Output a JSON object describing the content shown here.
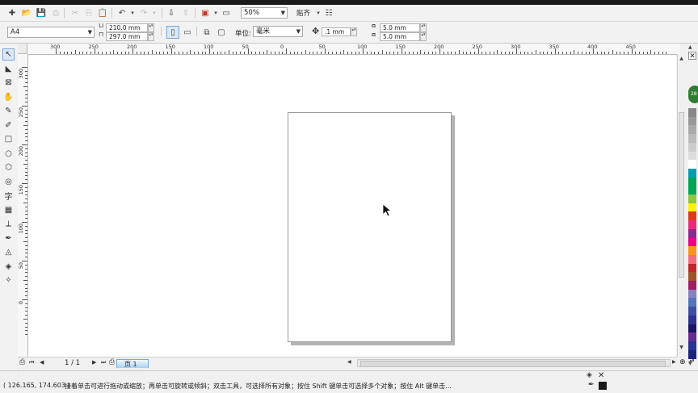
{
  "toolbar": {
    "zoom_value": "50%",
    "snap_label": "贴齐"
  },
  "property_bar": {
    "page_size": "A4",
    "width": "210.0 mm",
    "height": "297.0 mm",
    "units_label": "单位:",
    "units_value": "毫米",
    "nudge": ".1 mm",
    "dup_x": "5.0 mm",
    "dup_y": "5.0 mm"
  },
  "ruler": {
    "horizontal_ticks": [
      "300",
      "250",
      "200",
      "150",
      "100",
      "50",
      "0",
      "50",
      "100",
      "150",
      "200",
      "250",
      "300",
      "350",
      "400",
      "450"
    ],
    "vertical_ticks": [
      "300",
      "250",
      "200",
      "150",
      "100",
      "50",
      "0"
    ]
  },
  "tools": [
    {
      "name": "pick-tool",
      "glyph": "↖"
    },
    {
      "name": "shape-tool",
      "glyph": "◣"
    },
    {
      "name": "crop-tool",
      "glyph": "⊠"
    },
    {
      "name": "pan-tool",
      "glyph": "✋"
    },
    {
      "name": "freehand-tool",
      "glyph": "✎"
    },
    {
      "name": "smart-fill-tool",
      "glyph": "✐"
    },
    {
      "name": "rectangle-tool",
      "glyph": "□"
    },
    {
      "name": "ellipse-tool",
      "glyph": "○"
    },
    {
      "name": "polygon-tool",
      "glyph": "⬡"
    },
    {
      "name": "basic-shapes-tool",
      "glyph": "◎"
    },
    {
      "name": "text-tool",
      "glyph": "字"
    },
    {
      "name": "table-tool",
      "glyph": "▦"
    },
    {
      "name": "connector-tool",
      "glyph": "⟂"
    },
    {
      "name": "eyedropper-tool",
      "glyph": "✒"
    },
    {
      "name": "outline-tool",
      "glyph": "◬"
    },
    {
      "name": "fill-tool",
      "glyph": "◈"
    },
    {
      "name": "interactive-fill-tool",
      "glyph": "✧"
    }
  ],
  "palette_colors": [
    "#888888",
    "#999999",
    "#aaaaaa",
    "#bbbbbb",
    "#cccccc",
    "#dddddd",
    "#ffffff",
    "#00a0b0",
    "#00a651",
    "#00a651",
    "#8dc63f",
    "#fff200",
    "#e03a1e",
    "#ee2a7b",
    "#92278f",
    "#ec008c",
    "#f7941d",
    "#f26d7d",
    "#c1272d",
    "#a0522d",
    "#9e1f63",
    "#8781bd",
    "#5674b9",
    "#3e4fa3",
    "#2e3192",
    "#1b1464",
    "#662d91",
    "#283593",
    "#1a237e"
  ],
  "navigation": {
    "page_counter": "1 / 1",
    "page_tab": "页 1"
  },
  "status": {
    "coordinates": "( 126.165, 174.603 )",
    "hint": "接着单击可进行拖动或缩放；再单击可旋转或倾斜；双击工具，可选择所有对象；按住 Shift 键单击可选择多个对象；按住 Alt 键单击..."
  },
  "colors": {
    "accent": "#7aa6d6",
    "page_shadow": "#b3b3b3",
    "status_accent": "#2e7d32"
  }
}
